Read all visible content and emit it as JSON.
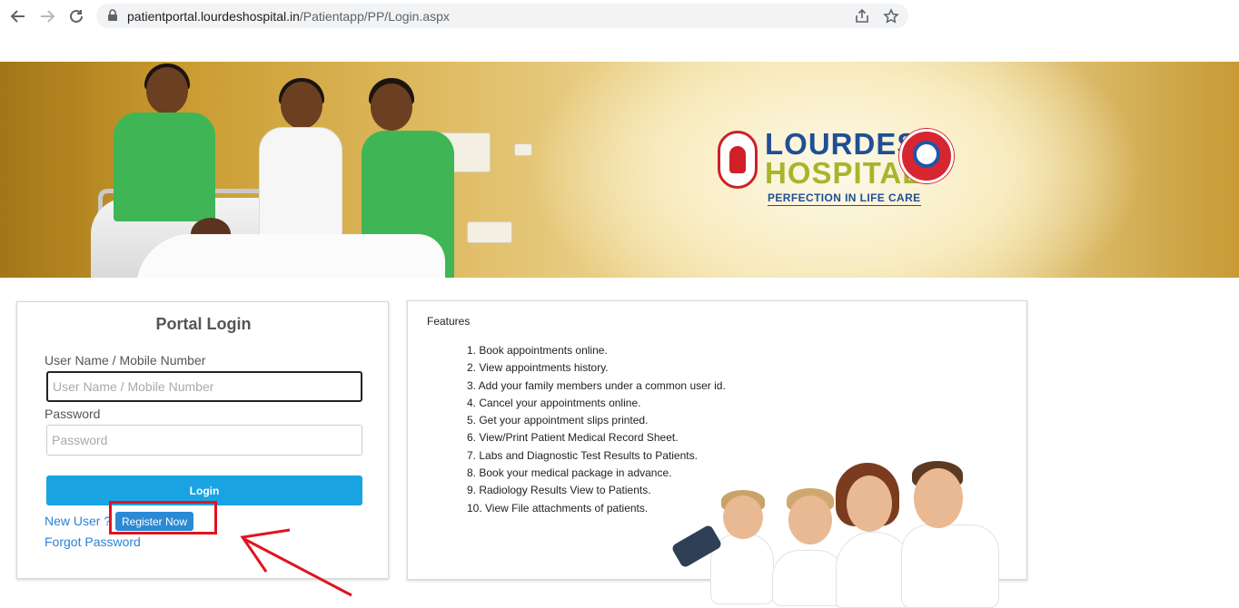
{
  "browser": {
    "url_host": "patientportal.lourdeshospital.in",
    "url_path": "/Patientapp/PP/Login.aspx",
    "back_icon": "arrow-left-icon",
    "forward_icon": "arrow-right-icon",
    "reload_icon": "reload-icon",
    "lock_icon": "lock-icon",
    "share_icon": "share-icon",
    "bookmark_icon": "star-icon"
  },
  "banner": {
    "logo_line1": "LOURDES",
    "logo_line2": "HOSPITAL",
    "tagline": "PERFECTION IN LIFE CARE",
    "colors": {
      "logo_blue": "#1f4f94",
      "logo_green": "#a8b52c",
      "logo_red": "#cf2027"
    }
  },
  "login": {
    "title": "Portal Login",
    "username_label": "User Name / Mobile Number",
    "username_placeholder": "User Name / Mobile Number",
    "password_label": "Password",
    "password_placeholder": "Password",
    "login_button": "Login",
    "new_user_text": "New User ?",
    "register_button": "Register Now",
    "forgot_password": "Forgot Password"
  },
  "features": {
    "title": "Features",
    "items": [
      "1. Book appointments online.",
      "2. View appointments history.",
      "3. Add your family members under a common user id.",
      "4. Cancel your appointments online.",
      "5. Get your appointment slips printed.",
      "6. View/Print Patient Medical Record Sheet.",
      "7. Labs and Diagnostic Test Results to Patients.",
      "8. Book your medical package in advance.",
      "9. Radiology Results View to Patients.",
      "10. View File attachments of patients."
    ]
  },
  "annotation": {
    "color": "#e0141e"
  }
}
